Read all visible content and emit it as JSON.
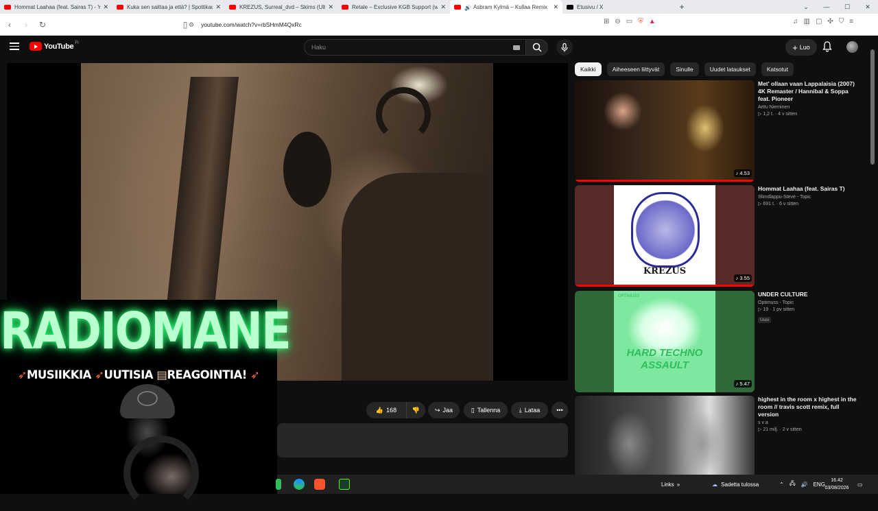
{
  "browser": {
    "tabs": [
      {
        "title": "Hommat Laahaa (feat. Sairas T) - YouTube",
        "icon": "youtube-favicon",
        "active": false
      },
      {
        "title": "Kuka sen saittaa ja että? | Spottikauppa",
        "icon": "youtube-favicon",
        "active": false
      },
      {
        "title": "KREZUS, Surreal_dvd – Skims (Ultra Slowed)",
        "icon": "youtube-favicon",
        "active": false
      },
      {
        "title": "Retale – Exclusive KGB Support (w/ Scum)",
        "icon": "youtube-favicon",
        "active": false
      },
      {
        "title": "Asbram Kylmä – Kullaa Remix",
        "icon": "youtube-favicon",
        "active": true
      },
      {
        "title": "Etusivu / X",
        "icon": "x-favicon",
        "active": false
      }
    ],
    "url": "youtube.com/watch?v=rbSHmM4QxRc"
  },
  "youtube": {
    "logo_text": "YouTube",
    "region": "FI",
    "search_placeholder": "Haku",
    "create_label": "Luo"
  },
  "overlay": {
    "title": "RADIOMANE",
    "subtitle_parts": [
      "MUSIIKKIA",
      "UUTISIA",
      "REAGOINTIA!"
    ]
  },
  "actions": {
    "like_count": "168",
    "share_label": "Jaa",
    "save_label": "Tallenna",
    "download_label": "Lataa"
  },
  "chips": [
    "Kaikki",
    "Aiheeseen liittyvät",
    "Sinulle",
    "Uudet lataukset",
    "Katsotut"
  ],
  "recommendations": [
    {
      "title": "Met' ollaan vaan Lappalaisia (2007) 4K Remaster / Hannibal & Soppa feat. Pioneer",
      "channel": "Arttu Nieminen",
      "views": "1,2 t. · 4 v sitten",
      "duration": "4.53",
      "badge": ""
    },
    {
      "title": "Hommat Laahaa (feat. Sairas T)",
      "channel": "Slimdlappu-Steve - Topic",
      "views": "691 t. · 6 v sitten",
      "duration": "3.55",
      "badge": "",
      "art_text": "KREZUS"
    },
    {
      "title": "UNDER CULTURE",
      "channel": "Optimuss - Topic",
      "views": "19 · 1 pv sitten",
      "duration": "5.47",
      "badge": "Uusi",
      "art_text": "HARD TECHNO ASSAULT",
      "art_top": "OPTIMUSS"
    },
    {
      "title": "highest in the room x highest in the room // travis scott remix, full version",
      "channel": "s v a",
      "views": "21 milj. · 2 v sitten",
      "duration": "",
      "badge": ""
    }
  ],
  "taskbar": {
    "links_label": "Links",
    "weather_label": "Sadetta tulossa",
    "lang": "ENG",
    "time": "16.42",
    "date": "03/08/2026"
  }
}
